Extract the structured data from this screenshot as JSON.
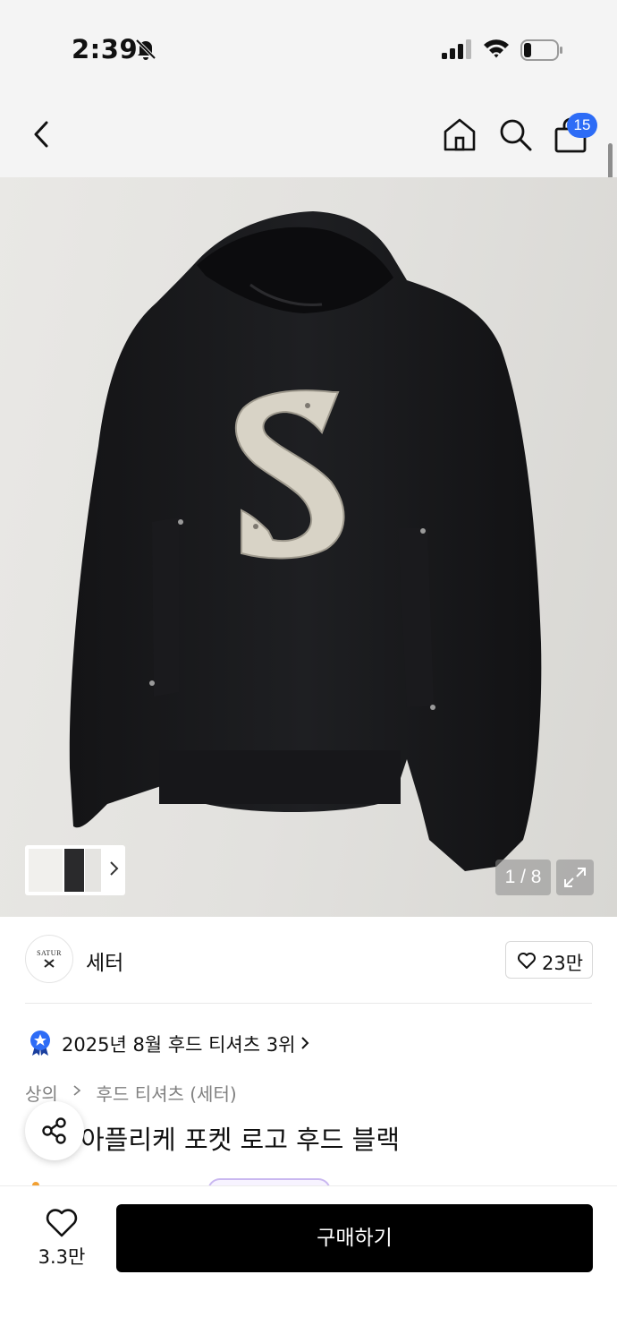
{
  "status_bar": {
    "time": "2:39",
    "icons": [
      "bell-slash-icon",
      "cellular-signal-icon",
      "wifi-icon",
      "battery-low-icon"
    ]
  },
  "nav": {
    "icons": [
      "back-chevron-icon",
      "home-icon",
      "search-icon",
      "shopping-bag-icon"
    ],
    "cart_count": "15"
  },
  "gallery": {
    "page_indicator": "1 / 8",
    "icons": [
      "expand-icon",
      "thumbnail-chevron-icon"
    ]
  },
  "brand": {
    "logo_text": "SATUR",
    "name": "세터",
    "likes": "23만"
  },
  "ranking": {
    "text": "2025년 8월 후드 티셔츠 3위",
    "badge_color": "#2d6cf6"
  },
  "breadcrumb": {
    "items": [
      "상의",
      "후드 티셔츠 (세터)"
    ]
  },
  "product": {
    "title": "아플리케 포켓 로고 후드 블랙"
  },
  "bottom_bar": {
    "wish_count": "3.3만",
    "buy_label": "구매하기"
  },
  "colors": {
    "accent": "#2d6cf6",
    "buy_button": "#000000",
    "background_header": "#f4f4f4"
  }
}
